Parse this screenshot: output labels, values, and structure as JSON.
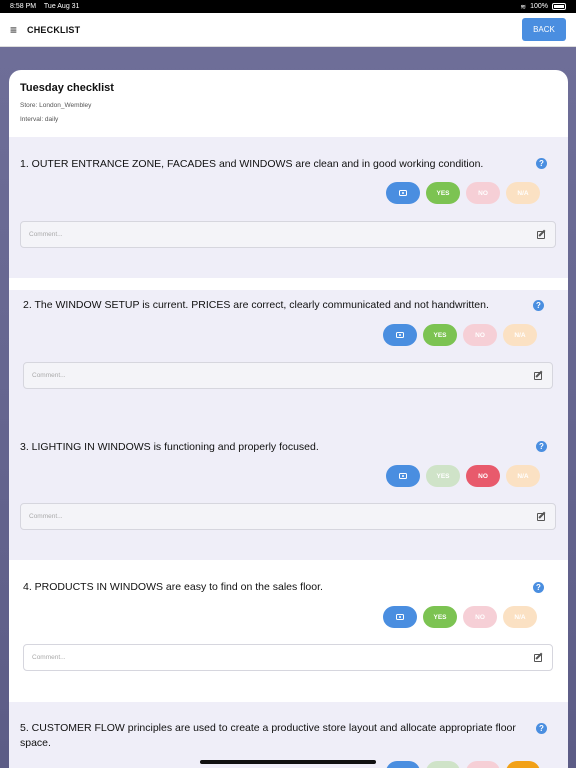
{
  "status_bar": {
    "time": "8:58 PM",
    "date": "Tue Aug 31",
    "battery": "100%"
  },
  "top_bar": {
    "title": "CHECKLIST",
    "back_label": "BACK"
  },
  "checklist": {
    "title": "Tuesday checklist",
    "store": "Store: London_Wembley",
    "interval": "Interval: daily"
  },
  "common": {
    "comment_placeholder": "Comment...",
    "yes": "YES",
    "no": "NO",
    "na": "N/A"
  },
  "questions": [
    {
      "text": "1. OUTER ENTRANCE ZONE, FACADES and WINDOWS are clean and in good working condition.",
      "answer": "yes"
    },
    {
      "text": "2. The WINDOW SETUP is current. PRICES are correct, clearly communicated and not handwritten.",
      "answer": "yes"
    },
    {
      "text": "3. LIGHTING IN WINDOWS is functioning and properly focused.",
      "answer": "no"
    },
    {
      "text": "4. PRODUCTS IN WINDOWS are easy to find on the sales floor.",
      "answer": "yes"
    },
    {
      "text": "5. CUSTOMER FLOW principles are used to create a productive store layout and allocate appropriate floor space.",
      "answer": "na"
    }
  ],
  "colors": {
    "accent": "#4a8ee0",
    "yes": "#7cc352",
    "no": "#e85a6c",
    "na": "#f2a117"
  }
}
